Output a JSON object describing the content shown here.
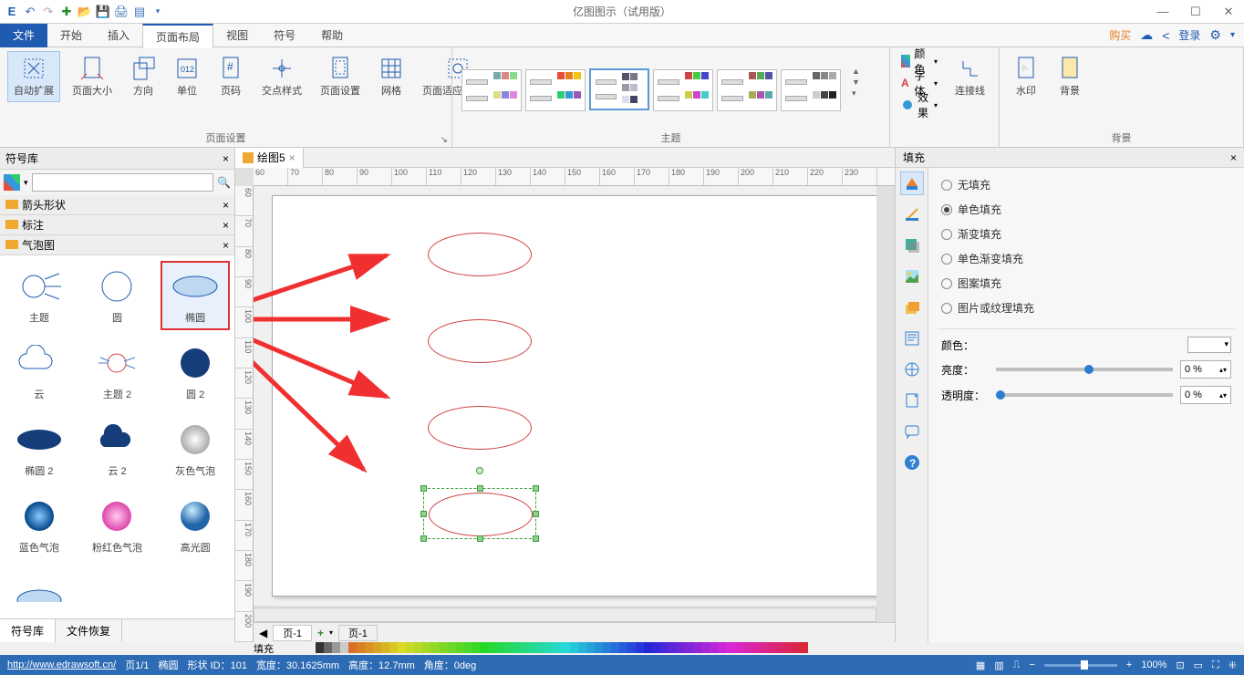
{
  "app_title": "亿图图示（试用版）",
  "menus": {
    "file": "文件",
    "items": [
      "开始",
      "插入",
      "页面布局",
      "视图",
      "符号",
      "帮助"
    ],
    "active_index": 2,
    "right": {
      "buy": "购买",
      "login": "登录"
    }
  },
  "ribbon": {
    "page_setup": {
      "label": "页面设置",
      "items": [
        "自动扩展",
        "页面大小",
        "方向",
        "单位",
        "页码",
        "交点样式",
        "页面设置",
        "网格",
        "页面适应到绘图"
      ]
    },
    "theme": {
      "label": "主题"
    },
    "format": {
      "color": "颜色",
      "font": "字体",
      "effect": "效果",
      "connector": "连接线"
    },
    "bg": {
      "label": "背景",
      "items": [
        "水印",
        "背景"
      ]
    }
  },
  "symbol_panel": {
    "title": "符号库",
    "categories": [
      "箭头形状",
      "标注",
      "气泡图"
    ],
    "shapes": [
      [
        "主题",
        "圆",
        "椭圆"
      ],
      [
        "云",
        "主题 2",
        "圆 2"
      ],
      [
        "椭圆 2",
        "云 2",
        "灰色气泡"
      ],
      [
        "蓝色气泡",
        "粉红色气泡",
        "高光圆"
      ]
    ],
    "selected": "椭圆",
    "tabs": [
      "符号库",
      "文件恢复"
    ]
  },
  "doc": {
    "tab": "绘图5",
    "ruler_h": [
      "60",
      "70",
      "80",
      "90",
      "100",
      "110",
      "120",
      "130",
      "140",
      "150",
      "160",
      "170",
      "180",
      "190",
      "200",
      "210",
      "220",
      "230"
    ],
    "ruler_v": [
      "60",
      "70",
      "80",
      "90",
      "100",
      "110",
      "120",
      "130",
      "140",
      "150",
      "160",
      "170",
      "180",
      "190",
      "200"
    ],
    "page_tab": "页-1",
    "fill_label": "填充"
  },
  "fill_panel": {
    "title": "填充",
    "options": [
      "无填充",
      "单色填充",
      "渐变填充",
      "单色渐变填充",
      "图案填充",
      "图片或纹理填充"
    ],
    "selected_index": 1,
    "color_label": "颜色：",
    "brightness_label": "亮度：",
    "brightness_value": "0 %",
    "opacity_label": "透明度：",
    "opacity_value": "0 %"
  },
  "status": {
    "url": "http://www.edrawsoft.cn/",
    "page": "页1/1",
    "shape": "椭圆",
    "shape_id": "形状 ID：101",
    "width": "宽度：30.1625mm",
    "height": "高度：12.7mm",
    "angle": "角度：0deg",
    "zoom": "100%"
  }
}
